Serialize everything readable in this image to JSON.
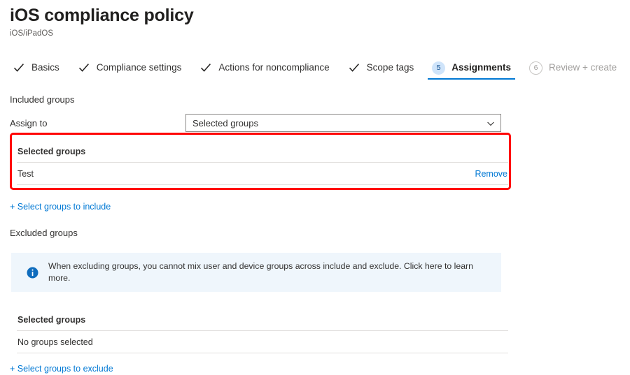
{
  "header": {
    "title": "iOS compliance policy",
    "subtitle": "iOS/iPadOS"
  },
  "wizard": {
    "tabs": [
      {
        "label": "Basics",
        "state": "completed",
        "marker": "check"
      },
      {
        "label": "Compliance settings",
        "state": "completed",
        "marker": "check"
      },
      {
        "label": "Actions for noncompliance",
        "state": "completed",
        "marker": "check"
      },
      {
        "label": "Scope tags",
        "state": "completed",
        "marker": "check"
      },
      {
        "label": "Assignments",
        "state": "active",
        "marker": "5"
      },
      {
        "label": "Review + create",
        "state": "disabled",
        "marker": "6"
      }
    ]
  },
  "included": {
    "section_label": "Included groups",
    "assign_to_label": "Assign to",
    "assign_to_value": "Selected groups",
    "table": {
      "header": "Selected groups",
      "rows": [
        {
          "name": "Test",
          "action": "Remove"
        }
      ]
    },
    "add_link": "+ Select groups to include"
  },
  "excluded": {
    "section_label": "Excluded groups",
    "info_text": "When excluding groups, you cannot mix user and device groups across include and exclude. Click here to learn more.",
    "table": {
      "header": "Selected groups",
      "empty_text": "No groups selected"
    },
    "add_link": "+ Select groups to exclude"
  },
  "colors": {
    "accent": "#0078d4",
    "link": "#0078d4",
    "callout": "#ff0000",
    "info_bg": "#eff6fc",
    "badge_active_bg": "#cfe4fa",
    "disabled_text": "#a19f9d"
  },
  "icons": {
    "check": "check-icon",
    "chevron_down": "chevron-down-icon",
    "info": "info-icon"
  }
}
